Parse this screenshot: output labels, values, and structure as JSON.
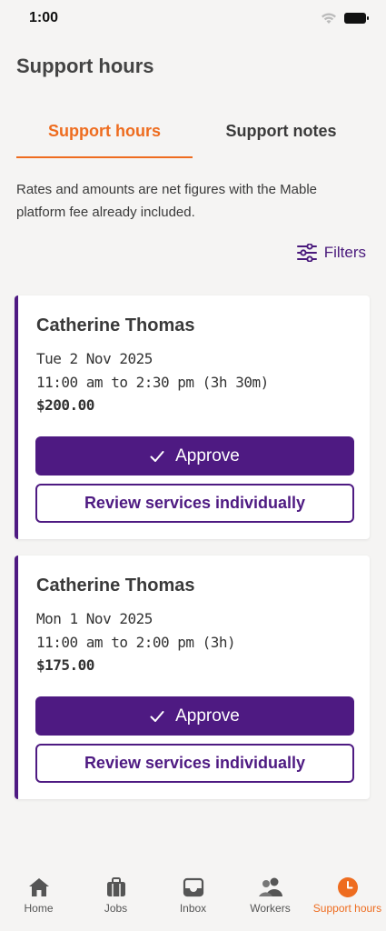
{
  "status": {
    "time": "1:00"
  },
  "page": {
    "title": "Support hours"
  },
  "tabs": [
    {
      "label": "Support hours",
      "active": true
    },
    {
      "label": "Support notes",
      "active": false
    }
  ],
  "info": "Rates and amounts are net figures with the Mable platform fee already included.",
  "filters_label": "Filters",
  "cards": [
    {
      "name": "Catherine Thomas",
      "date": "Tue 2 Nov 2025",
      "time": "11:00 am to 2:30 pm (3h 30m)",
      "amount": "$200.00",
      "approve_label": "Approve",
      "review_label": "Review services individually"
    },
    {
      "name": "Catherine Thomas",
      "date": "Mon 1 Nov 2025",
      "time": "11:00 am to 2:00 pm (3h)",
      "amount": "$175.00",
      "approve_label": "Approve",
      "review_label": "Review services individually"
    }
  ],
  "nav": [
    {
      "label": "Home",
      "icon": "home-icon"
    },
    {
      "label": "Jobs",
      "icon": "briefcase-icon"
    },
    {
      "label": "Inbox",
      "icon": "inbox-icon"
    },
    {
      "label": "Workers",
      "icon": "people-icon"
    },
    {
      "label": "Support hours",
      "icon": "clock-icon",
      "active": true
    }
  ],
  "colors": {
    "accent": "#ee6c1f",
    "primary": "#4e1a82",
    "background": "#f5f4f3"
  }
}
